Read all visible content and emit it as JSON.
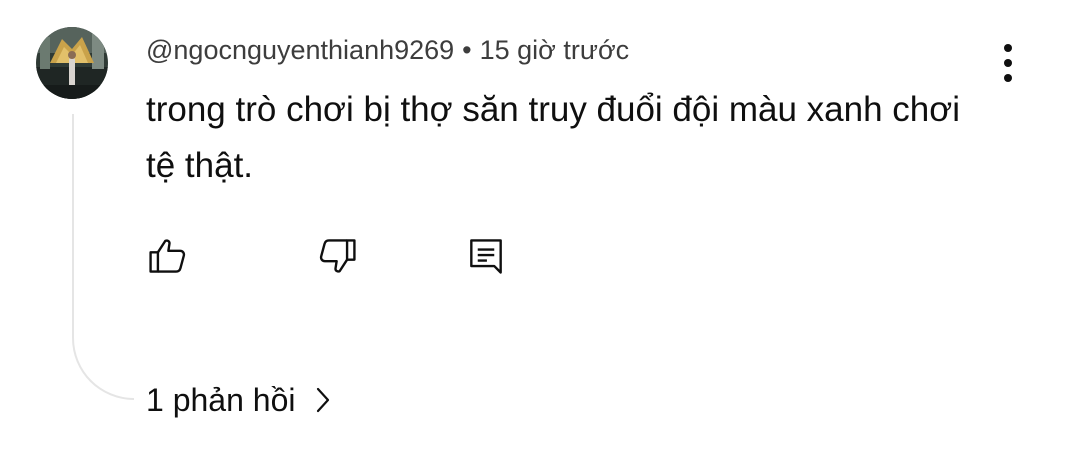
{
  "comment": {
    "author": "@ngocnguyenthianh9269",
    "separator": "•",
    "time": "15 giờ trước",
    "text": "trong trò chơi bị thợ săn truy đuổi đội màu xanh chơi tệ thật.",
    "avatar_icon": "user-avatar-photo"
  },
  "actions": {
    "like_icon": "thumbs-up-icon",
    "dislike_icon": "thumbs-down-icon",
    "reply_icon": "comment-reply-icon",
    "more_icon": "more-vertical-icon"
  },
  "replies": {
    "label": "1 phản hồi",
    "icon": "chevron-right-icon"
  },
  "colors": {
    "text": "#0f0f0f",
    "meta_text": "#3d3d3d",
    "thread_line": "#e5e5e5",
    "background": "#ffffff"
  }
}
